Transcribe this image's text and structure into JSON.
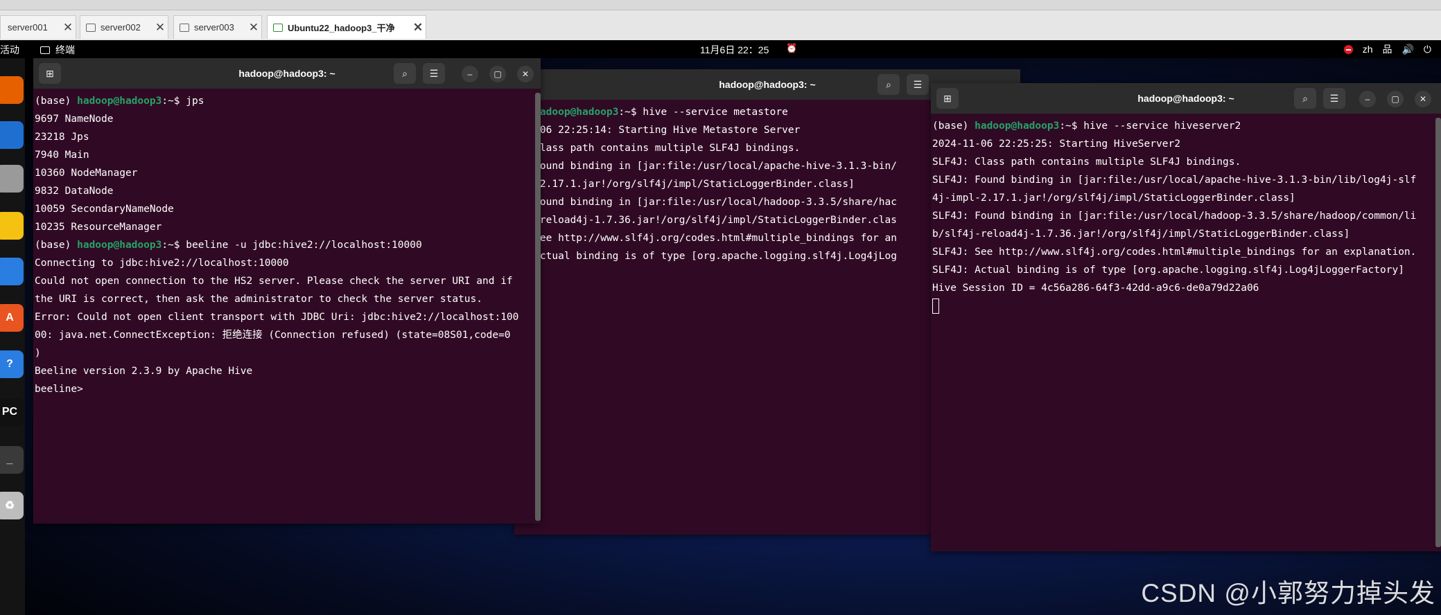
{
  "vm_tabs": [
    {
      "label": "server001",
      "active": false
    },
    {
      "label": "server002",
      "active": false
    },
    {
      "label": "server003",
      "active": false
    },
    {
      "label": "Ubuntu22_hadoop3_干净",
      "active": true
    }
  ],
  "topbar": {
    "activities": "活动",
    "app_name": "终端",
    "clock": "11月6日 22：25",
    "lang": "zh"
  },
  "windows": {
    "left": {
      "title": "hadoop@hadoop3: ~",
      "lines": [
        {
          "prompt": true,
          "env": "(base) ",
          "user": "hadoop@hadoop3",
          "tail": ":~$ jps"
        },
        {
          "text": "9697 NameNode"
        },
        {
          "text": "23218 Jps"
        },
        {
          "text": "7940 Main"
        },
        {
          "text": "10360 NodeManager"
        },
        {
          "text": "9832 DataNode"
        },
        {
          "text": "10059 SecondaryNameNode"
        },
        {
          "text": "10235 ResourceManager"
        },
        {
          "prompt": true,
          "env": "(base) ",
          "user": "hadoop@hadoop3",
          "tail": ":~$ beeline -u jdbc:hive2://localhost:10000"
        },
        {
          "text": "Connecting to jdbc:hive2://localhost:10000"
        },
        {
          "text": "Could not open connection to the HS2 server. Please check the server URI and if"
        },
        {
          "text": "the URI is correct, then ask the administrator to check the server status."
        },
        {
          "text": "Error: Could not open client transport with JDBC Uri: jdbc:hive2://localhost:100"
        },
        {
          "text": "00: java.net.ConnectException: 拒绝连接 (Connection refused) (state=08S01,code=0"
        },
        {
          "text": ")"
        },
        {
          "text": "Beeline version 2.3.9 by Apache Hive"
        },
        {
          "text": "beeline>"
        }
      ]
    },
    "middle": {
      "title": "hadoop@hadoop3: ~",
      "lines": [
        {
          "prompt": true,
          "env": "e) ",
          "user": "hadoop@hadoop3",
          "tail": ":~$ hive --service metastore"
        },
        {
          "text": "-11-06 22:25:14: Starting Hive Metastore Server"
        },
        {
          "text": "J: Class path contains multiple SLF4J bindings."
        },
        {
          "text": "J: Found binding in [jar:file:/usr/local/apache-hive-3.1.3-bin/"
        },
        {
          "text": "mpl-2.17.1.jar!/org/slf4j/impl/StaticLoggerBinder.class]"
        },
        {
          "text": "J: Found binding in [jar:file:/usr/local/hadoop-3.3.5/share/hac"
        },
        {
          "text": "f4j-reload4j-1.7.36.jar!/org/slf4j/impl/StaticLoggerBinder.clas"
        },
        {
          "text": "J: See http://www.slf4j.org/codes.html#multiple_bindings for an"
        },
        {
          "text": "J: Actual binding is of type [org.apache.logging.slf4j.Log4jLog"
        }
      ]
    },
    "right": {
      "title": "hadoop@hadoop3: ~",
      "lines": [
        {
          "prompt": true,
          "env": "(base) ",
          "user": "hadoop@hadoop3",
          "tail": ":~$ hive --service hiveserver2"
        },
        {
          "text": "2024-11-06 22:25:25: Starting HiveServer2"
        },
        {
          "text": "SLF4J: Class path contains multiple SLF4J bindings."
        },
        {
          "text": "SLF4J: Found binding in [jar:file:/usr/local/apache-hive-3.1.3-bin/lib/log4j-slf"
        },
        {
          "text": "4j-impl-2.17.1.jar!/org/slf4j/impl/StaticLoggerBinder.class]"
        },
        {
          "text": "SLF4J: Found binding in [jar:file:/usr/local/hadoop-3.3.5/share/hadoop/common/li"
        },
        {
          "text": "b/slf4j-reload4j-1.7.36.jar!/org/slf4j/impl/StaticLoggerBinder.class]"
        },
        {
          "text": "SLF4J: See http://www.slf4j.org/codes.html#multiple_bindings for an explanation."
        },
        {
          "text": "SLF4J: Actual binding is of type [org.apache.logging.slf4j.Log4jLoggerFactory]"
        },
        {
          "text": "Hive Session ID = 4c56a286-64f3-42dd-a9c6-de0a79d22a06"
        }
      ]
    }
  },
  "dock": [
    {
      "name": "firefox-icon",
      "glyph": "",
      "color": "#e66000"
    },
    {
      "name": "thunderbird-icon",
      "glyph": "",
      "color": "#1f6fd1"
    },
    {
      "name": "files-icon",
      "glyph": "",
      "color": "#9a9a9a"
    },
    {
      "name": "rhythmbox-icon",
      "glyph": "",
      "color": "#f5c211"
    },
    {
      "name": "writer-icon",
      "glyph": "",
      "color": "#2a7de1"
    },
    {
      "name": "app-center-icon",
      "glyph": "A",
      "color": "#e95420"
    },
    {
      "name": "help-icon",
      "glyph": "?",
      "color": "#2a7de1"
    },
    {
      "name": "pycharm-icon",
      "glyph": "PC",
      "color": "#111111"
    },
    {
      "name": "terminal-icon",
      "glyph": "_",
      "color": "#3a3a3a"
    },
    {
      "name": "trash-icon",
      "glyph": "♻",
      "color": "#bdbdbd"
    }
  ],
  "watermark": "CSDN @小郭努力掉头发",
  "colors": {
    "terminal_bg": "#300a24",
    "prompt_user": "#26a269",
    "titlebar": "#2c2c2c"
  }
}
